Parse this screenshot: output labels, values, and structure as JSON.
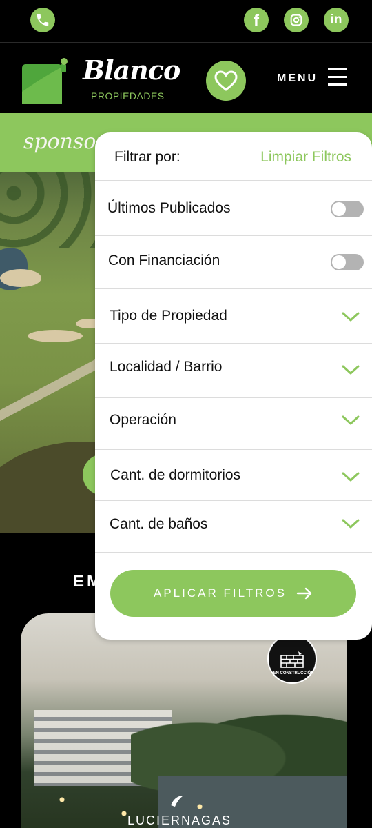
{
  "colors": {
    "brand_green": "#8dc75d",
    "background": "#000000",
    "panel": "#ffffff"
  },
  "topbar": {
    "icons": [
      "phone-icon",
      "facebook-icon",
      "instagram-icon",
      "linkedin-icon"
    ],
    "facebook_glyph": "f",
    "linkedin_glyph": "in"
  },
  "header": {
    "brand_name": "Blanco",
    "brand_sub": "PROPIEDADES",
    "menu_label": "MENU"
  },
  "sponsor": {
    "text": "sponsor"
  },
  "section": {
    "title_visible": "EM"
  },
  "card": {
    "badge": "EN CONSTRUCCIÓN",
    "name": "LUCIERNAGAS"
  },
  "filter": {
    "title": "Filtrar por:",
    "clear_label": "Limpiar Filtros",
    "toggles": [
      {
        "label": "Últimos Publicados",
        "on": false
      },
      {
        "label": "Con Financiación",
        "on": false
      }
    ],
    "dropdowns": [
      {
        "label": "Tipo de Propiedad"
      },
      {
        "label": "Localidad / Barrio"
      },
      {
        "label": "Operación"
      },
      {
        "label": "Cant. de dormitorios"
      },
      {
        "label": "Cant. de baños"
      }
    ],
    "apply_label": "APLICAR FILTROS"
  }
}
